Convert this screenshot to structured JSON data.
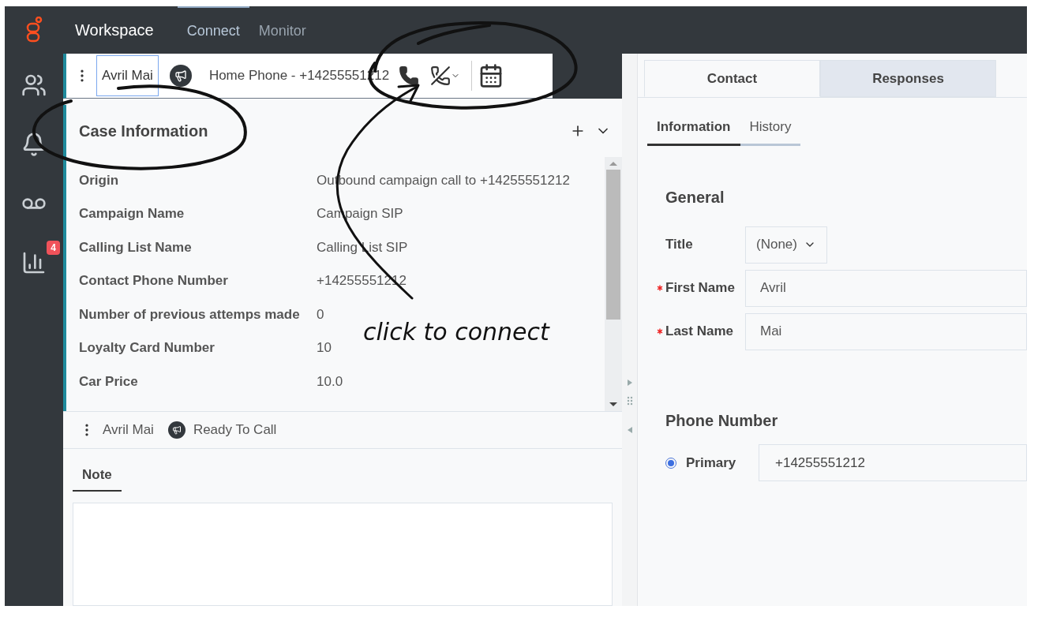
{
  "top_bar": {
    "app_name": "Workspace",
    "nav": [
      {
        "label": "Connect",
        "selected": true
      },
      {
        "label": "Monitor",
        "selected": false
      }
    ]
  },
  "left_rail": [
    {
      "kind": "team"
    },
    {
      "kind": "bell"
    },
    {
      "kind": "voicemail"
    },
    {
      "kind": "chart",
      "badge": "4"
    }
  ],
  "interaction": {
    "contact_name": "Avril Mai",
    "phone": "Home Phone - +14255551212"
  },
  "case_information": {
    "title": "Case Information",
    "rows": [
      {
        "label": "Origin",
        "value": "Outbound campaign call to +14255551212"
      },
      {
        "label": "Campaign Name",
        "value": "Campaign SIP"
      },
      {
        "label": "Calling List Name",
        "value": "Calling List SIP"
      },
      {
        "label": "Contact Phone Number",
        "value": "+14255551212"
      },
      {
        "label": "Number of previous attemps made",
        "value": "0"
      },
      {
        "label": "Loyalty Card Number",
        "value": "10"
      },
      {
        "label": "Car Price",
        "value": "10.0"
      }
    ]
  },
  "second_interaction": {
    "contact_name": "Avril Mai",
    "status": "Ready To Call"
  },
  "note_tabs": [
    {
      "label": "Note",
      "selected": true
    }
  ],
  "right_tabs": [
    {
      "label": "Contact",
      "selected": true
    },
    {
      "label": "Responses",
      "selected": false
    }
  ],
  "sub_tabs": [
    {
      "label": "Information",
      "selected": true
    },
    {
      "label": "History",
      "selected": false
    }
  ],
  "general": {
    "title": "General",
    "fields": [
      {
        "kind": "select",
        "label": "Title",
        "value": "(None)",
        "required": false
      },
      {
        "kind": "text",
        "label": "First Name",
        "value": "Avril",
        "required": true
      },
      {
        "kind": "text",
        "label": "Last Name",
        "value": "Mai",
        "required": true
      }
    ]
  },
  "phone_section": {
    "title": "Phone Number",
    "entries": [
      {
        "label": "Primary",
        "value": "+14255551212",
        "selected": true
      }
    ]
  },
  "annotation": {
    "text": "click to connect"
  }
}
